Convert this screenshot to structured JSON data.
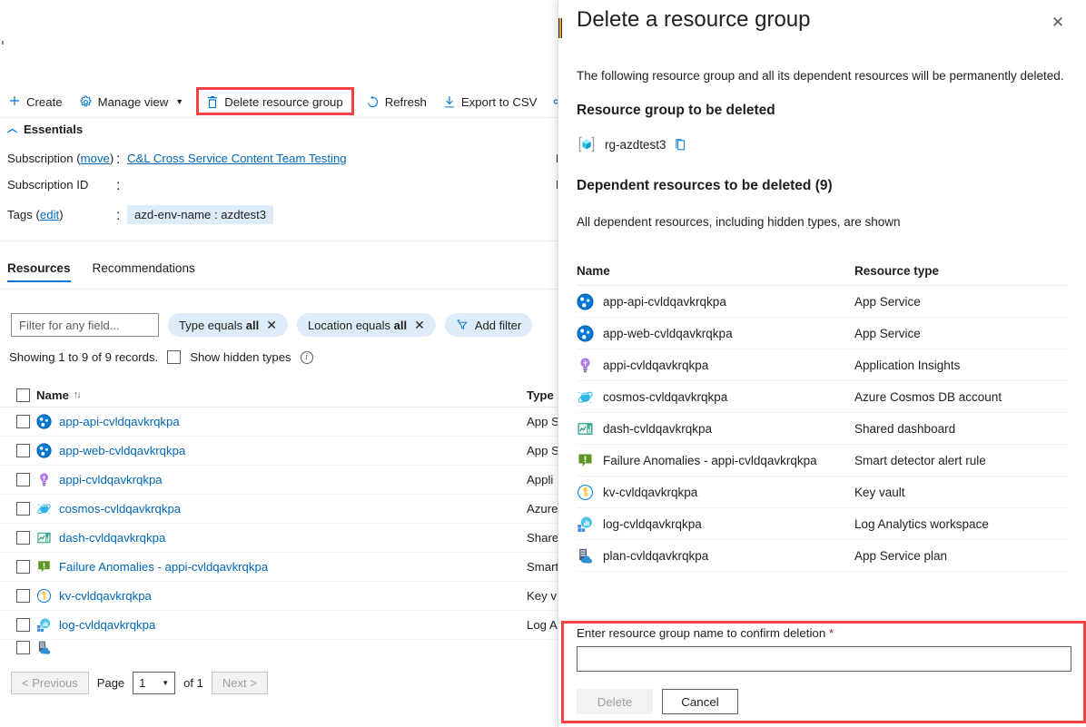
{
  "toolbar": {
    "create_label": "Create",
    "manage_view_label": "Manage view",
    "delete_rg_label": "Delete resource group",
    "refresh_label": "Refresh",
    "export_csv_label": "Export to CSV",
    "highlight_color": "#f5413f"
  },
  "essentials": {
    "header": "Essentials",
    "subscription_label": "Subscription",
    "subscription_move": "move",
    "subscription_value": "C&L Cross Service Content Team Testing",
    "subscription_id_label": "Subscription ID",
    "subscription_id_value": "",
    "tags_label": "Tags",
    "tags_edit": "edit",
    "tags_value": "azd-env-name : azdtest3",
    "colon": ":",
    "clipped_right_1": "D",
    "clipped_right_2": "L"
  },
  "tabs": [
    {
      "label": "Resources",
      "active": true
    },
    {
      "label": "Recommendations",
      "active": false
    }
  ],
  "filters": {
    "search_placeholder": "Filter for any field...",
    "search_value": "",
    "pills": [
      {
        "prefix": "Type equals",
        "value": "all"
      },
      {
        "prefix": "Location equals",
        "value": "all"
      }
    ],
    "add_filter_label": "Add filter"
  },
  "showing": {
    "records_text": "Showing 1 to 9 of 9 records.",
    "hidden_types_label": "Show hidden types",
    "hidden_types_checked": false
  },
  "grid": {
    "columns": [
      "Name",
      "Type"
    ],
    "sort_indicator": "↑↓",
    "rows": [
      {
        "name": "app-api-cvldqavkrqkpa",
        "type": "App S",
        "icon": "app-service-icon"
      },
      {
        "name": "app-web-cvldqavkrqkpa",
        "type": "App S",
        "icon": "app-service-icon"
      },
      {
        "name": "appi-cvldqavkrqkpa",
        "type": "Appli",
        "icon": "application-insights-icon"
      },
      {
        "name": "cosmos-cvldqavkrqkpa",
        "type": "Azure",
        "icon": "cosmos-db-icon"
      },
      {
        "name": "dash-cvldqavkrqkpa",
        "type": "Share",
        "icon": "shared-dashboard-icon"
      },
      {
        "name": "Failure Anomalies - appi-cvldqavkrqkpa",
        "type": "Smart",
        "icon": "smart-detector-icon"
      },
      {
        "name": "kv-cvldqavkrqkpa",
        "type": "Key v",
        "icon": "key-vault-icon"
      },
      {
        "name": "log-cvldqavkrqkpa",
        "type": "Log A",
        "icon": "log-analytics-icon"
      }
    ]
  },
  "pagination": {
    "previous_label": "< Previous",
    "page_label": "Page",
    "page_value": "1",
    "of_label": "of 1",
    "next_label": "Next >"
  },
  "panel": {
    "title": "Delete a resource group",
    "close_icon": "✕",
    "intro": "The following resource group and all its dependent resources will be permanently deleted.",
    "rg_heading": "Resource group to be deleted",
    "rg_name": "rg-azdtest3",
    "copy_icon": "copy-icon",
    "dependents_heading": "Dependent resources to be deleted (9)",
    "dependents_subtext": "All dependent resources, including hidden types, are shown",
    "table_columns": [
      "Name",
      "Resource type"
    ],
    "resources": [
      {
        "name": "app-api-cvldqavkrqkpa",
        "type": "App Service",
        "icon": "app-service-icon"
      },
      {
        "name": "app-web-cvldqavkrqkpa",
        "type": "App Service",
        "icon": "app-service-icon"
      },
      {
        "name": "appi-cvldqavkrqkpa",
        "type": "Application Insights",
        "icon": "application-insights-icon"
      },
      {
        "name": "cosmos-cvldqavkrqkpa",
        "type": "Azure Cosmos DB account",
        "icon": "cosmos-db-icon"
      },
      {
        "name": "dash-cvldqavkrqkpa",
        "type": "Shared dashboard",
        "icon": "shared-dashboard-icon"
      },
      {
        "name": "Failure Anomalies - appi-cvldqavkrqkpa",
        "type": "Smart detector alert rule",
        "icon": "smart-detector-icon"
      },
      {
        "name": "kv-cvldqavkrqkpa",
        "type": "Key vault",
        "icon": "key-vault-icon"
      },
      {
        "name": "log-cvldqavkrqkpa",
        "type": "Log Analytics workspace",
        "icon": "log-analytics-icon"
      },
      {
        "name": "plan-cvldqavkrqkpa",
        "type": "App Service plan",
        "icon": "app-service-plan-icon"
      }
    ],
    "confirm_label": "Enter resource group name to confirm deletion",
    "confirm_required_marker": "*",
    "confirm_value": "",
    "delete_label": "Delete",
    "cancel_label": "Cancel",
    "highlight_color": "#f5413f"
  }
}
